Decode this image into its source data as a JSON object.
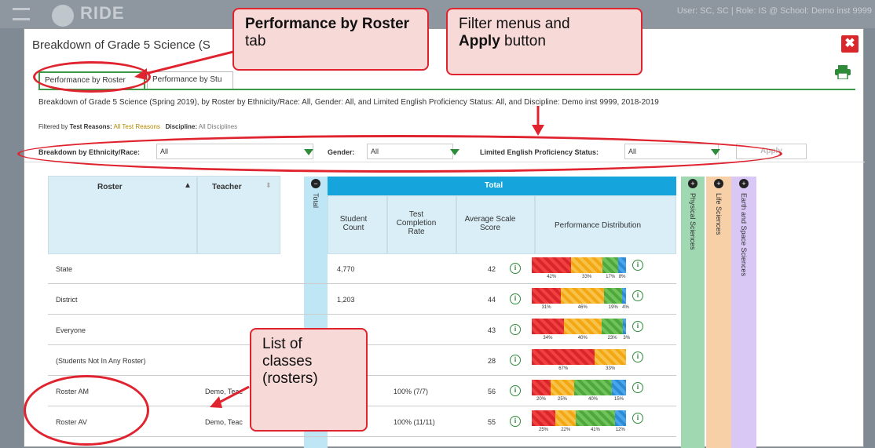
{
  "topbar": {
    "brand": "RIDE",
    "user": "User: SC, SC | Role: IS @ School: Demo inst 9999"
  },
  "modal": {
    "title": "Breakdown of Grade 5 Science (S",
    "close": "✖"
  },
  "tabs": [
    {
      "label": "Performance by Roster"
    },
    {
      "label": "Performance by Stu"
    }
  ],
  "description": "Breakdown of Grade 5 Science (Spring 2019), by Roster by Ethnicity/Race: All, Gender: All, and Limited English Proficiency Status: All, and Discipline: Demo inst 9999, 2018-2019",
  "filtered": {
    "prefix": "Filtered by ",
    "reasons_label": "Test Reasons:",
    "reasons_value": "All Test Reasons",
    "discipline_label": "Discipline:",
    "discipline_value": "All Disciplines"
  },
  "filters": {
    "ethnicity_label": "Breakdown by Ethnicity/Race:",
    "ethnicity_value": "All",
    "gender_label": "Gender:",
    "gender_value": "All",
    "lep_label": "Limited English Proficiency Status:",
    "lep_value": "All",
    "apply_label": "Apply"
  },
  "table": {
    "headers": {
      "roster": "Roster",
      "teacher": "Teacher",
      "total_band": "Total",
      "total": "Total",
      "student_count": "Student Count",
      "completion": "Test Completion Rate",
      "avg_score": "Average Scale Score",
      "distribution": "Performance Distribution",
      "physical": "Physical Sciences",
      "life": "Life Sciences",
      "earth": "Earth and Space Sciences"
    },
    "rows": [
      {
        "roster": "State",
        "teacher": "",
        "count": "4,770",
        "completion": "",
        "score": "42",
        "dist": [
          42,
          33,
          17,
          8
        ],
        "labels": [
          "42%",
          "33%",
          "17%",
          "8%"
        ]
      },
      {
        "roster": "District",
        "teacher": "",
        "count": "1,203",
        "completion": "",
        "score": "44",
        "dist": [
          31,
          46,
          19,
          4
        ],
        "labels": [
          "31%",
          "46%",
          "19%",
          "4%"
        ]
      },
      {
        "roster": "Everyone",
        "teacher": "",
        "count": "",
        "completion": "",
        "score": "43",
        "dist": [
          34,
          40,
          23,
          3
        ],
        "labels": [
          "34%",
          "40%",
          "23%",
          "3%"
        ]
      },
      {
        "roster": "(Students Not In Any Roster)",
        "teacher": "",
        "count": "",
        "completion": "",
        "score": "28",
        "dist": [
          67,
          33,
          0,
          0
        ],
        "labels": [
          "67%",
          "33%",
          "",
          ""
        ]
      },
      {
        "roster": "Roster AM",
        "teacher": "Demo, Teac",
        "count": "",
        "completion": "100% (7/7)",
        "score": "56",
        "dist": [
          20,
          25,
          40,
          15
        ],
        "labels": [
          "20%",
          "25%",
          "40%",
          "15%"
        ]
      },
      {
        "roster": "Roster AV",
        "teacher": "Demo, Teac",
        "count": "",
        "completion": "100% (11/11)",
        "score": "55",
        "dist": [
          25,
          22,
          41,
          12
        ],
        "labels": [
          "25%",
          "22%",
          "41%",
          "12%"
        ]
      }
    ]
  },
  "callouts": {
    "tab_bold": "Performance by Roster",
    "tab_rest": " tab",
    "filter_line1": "Filter menus and",
    "filter_bold": "Apply",
    "filter_rest": " button",
    "classes": "List of classes (rosters)"
  },
  "colors": {
    "red": "#e0242f",
    "green": "#2e8b3a",
    "blue": "#15a5dc"
  }
}
